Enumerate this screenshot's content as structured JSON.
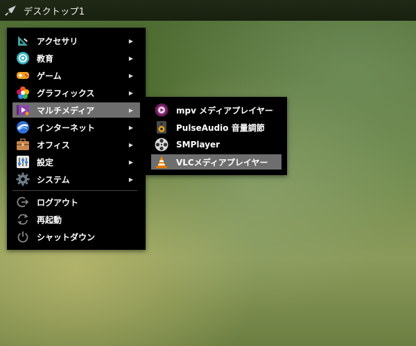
{
  "topbar": {
    "title": "デスクトップ1",
    "launcher_icon": "rocket-icon"
  },
  "main_menu": {
    "items": [
      {
        "label": "アクセサリ",
        "icon": "accessories-icon",
        "submenu": true
      },
      {
        "label": "教育",
        "icon": "education-icon",
        "submenu": true
      },
      {
        "label": "ゲーム",
        "icon": "gamepad-icon",
        "submenu": true
      },
      {
        "label": "グラフィックス",
        "icon": "graphics-icon",
        "submenu": true
      },
      {
        "label": "マルチメディア",
        "icon": "multimedia-icon",
        "submenu": true,
        "highlighted": true
      },
      {
        "label": "インターネット",
        "icon": "internet-icon",
        "submenu": true
      },
      {
        "label": "オフィス",
        "icon": "briefcase-icon",
        "submenu": true
      },
      {
        "label": "設定",
        "icon": "settings-icon",
        "submenu": true
      },
      {
        "label": "システム",
        "icon": "gear-icon",
        "submenu": true
      }
    ],
    "session": [
      {
        "label": "ログアウト",
        "icon": "logout-icon"
      },
      {
        "label": "再起動",
        "icon": "restart-icon"
      },
      {
        "label": "シャットダウン",
        "icon": "power-icon"
      }
    ],
    "arrow": "▶"
  },
  "sub_menu": {
    "items": [
      {
        "label": "mpv メディアプレイヤー",
        "icon": "mpv-icon"
      },
      {
        "label": "PulseAudio 音量調節",
        "icon": "speaker-icon"
      },
      {
        "label": "SMPlayer",
        "icon": "smplayer-icon"
      },
      {
        "label": "VLCメディアプレイヤー",
        "icon": "vlc-cone-icon",
        "highlighted": true
      }
    ]
  },
  "colors": {
    "menu_bg": "#000000",
    "highlight_bg": "#6e6e6e",
    "topbar_bg": "#1c2614"
  }
}
